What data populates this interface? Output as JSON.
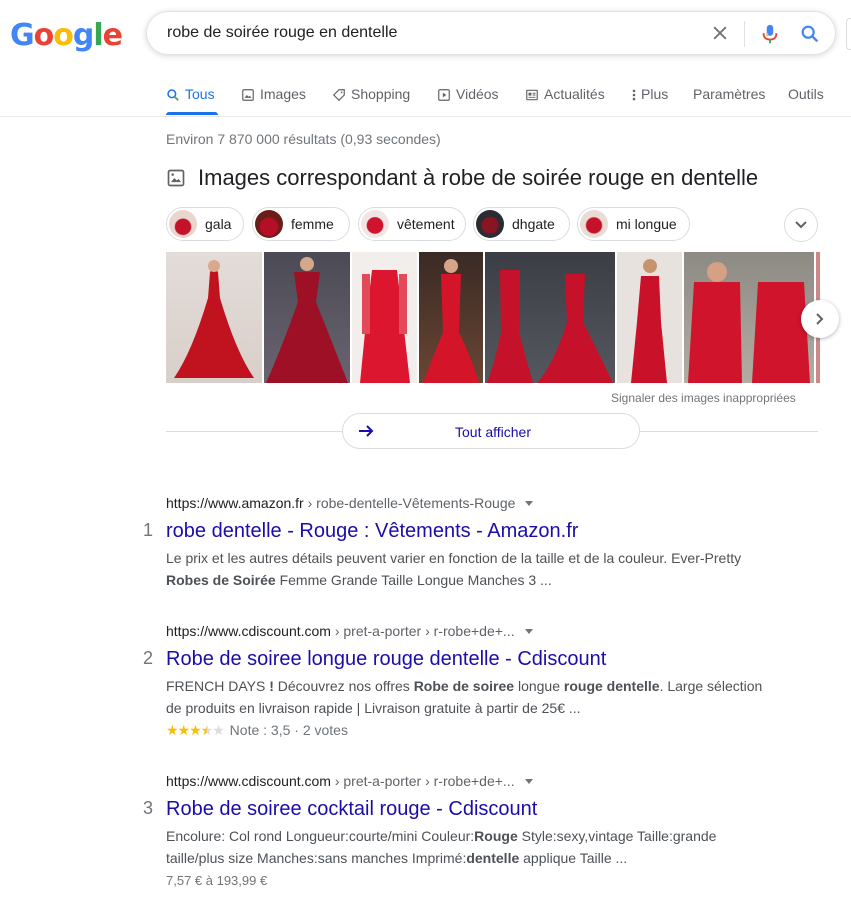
{
  "logo": "Google",
  "colors": {
    "blue": "#4285F4",
    "red": "#EA4335",
    "yellow": "#FBBC05",
    "green": "#34A853",
    "link": "#1a0dab",
    "accent": "#1a73e8"
  },
  "search": {
    "query": "robe de soirée rouge en dentelle"
  },
  "tabs": [
    {
      "label": "Tous",
      "icon": "search-icon"
    },
    {
      "label": "Images",
      "icon": "image-icon"
    },
    {
      "label": "Shopping",
      "icon": "tag-icon"
    },
    {
      "label": "Vidéos",
      "icon": "play-icon"
    },
    {
      "label": "Actualités",
      "icon": "news-icon"
    },
    {
      "label": "Plus",
      "icon": "more-vert-icon"
    },
    {
      "label": "Paramètres"
    },
    {
      "label": "Outils"
    }
  ],
  "stats": "Environ 7 870 000 résultats (0,93 secondes)",
  "images_section": {
    "heading": "Images correspondant à robe de soirée rouge en dentelle",
    "chips": [
      "gala",
      "femme",
      "vêtement",
      "dhgate",
      "mi longue"
    ],
    "report": "Signaler des images inappropriées",
    "show_all": "Tout afficher"
  },
  "results": [
    {
      "number": "1",
      "url": "https://www.amazon.fr",
      "crumb": " › robe-dentelle-Vêtements-Rouge",
      "title": "robe dentelle - Rouge : Vêtements - Amazon.fr",
      "snippet_1": "Le prix et les autres détails peuvent varier en fonction de la taille et de la couleur. Ever-Pretty",
      "snippet_2_bold": "Robes de Soirée",
      "snippet_2_rest": " Femme Grande Taille Longue Manches 3 ..."
    },
    {
      "number": "2",
      "url": "https://www.cdiscount.com",
      "crumb": " › pret-a-porter › r-robe+de+...",
      "title": "Robe de soiree longue rouge dentelle - Cdiscount",
      "s1": "FRENCH DAYS ",
      "s1b": "!",
      "s2": " Découvrez nos offres ",
      "s2b": "Robe de soiree",
      "s3": " longue ",
      "s3b": "rouge dentelle",
      "s4": ". Large sélection",
      "line2": "de produits en livraison rapide | Livraison gratuite à partir de 25€ ...",
      "rating_text": "Note : 3,5 · 2 votes",
      "rating_value": 3.5
    },
    {
      "number": "3",
      "url": "https://www.cdiscount.com",
      "crumb": " › pret-a-porter › r-robe+de+...",
      "title": "Robe de soiree cocktail rouge - Cdiscount",
      "l1a": "Encolure: Col rond Longueur:courte/mini Couleur:",
      "l1b": "Rouge",
      "l1c": " Style:sexy,vintage Taille:grande",
      "l2a": "taille/plus size Manches:sans manches Imprimé:",
      "l2b": "dentelle",
      "l2c": " applique Taille ...",
      "price": "7,57 € à 193,99 €"
    }
  ]
}
